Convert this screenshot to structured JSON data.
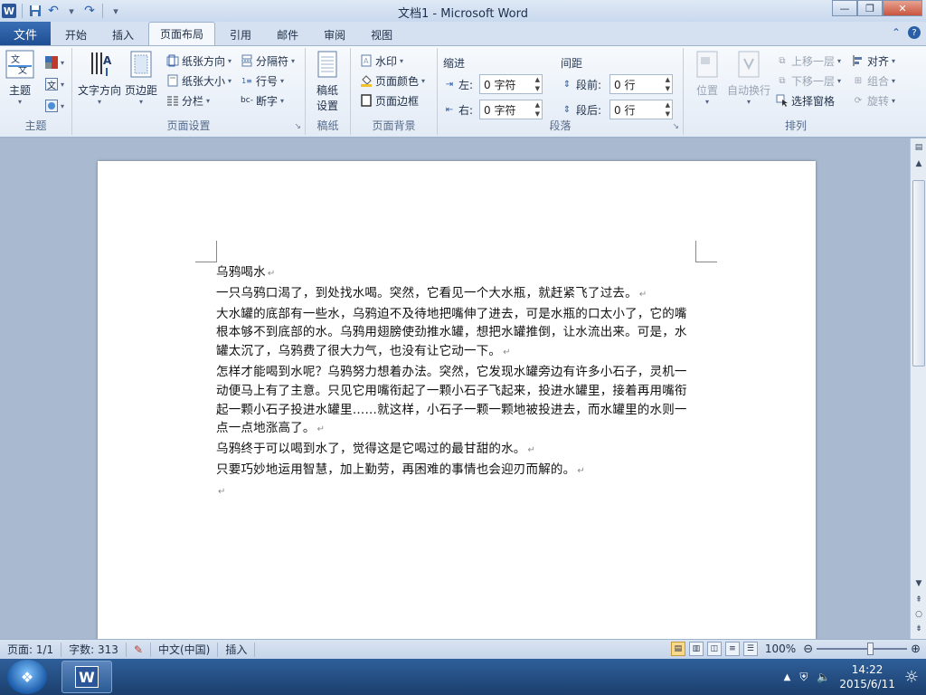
{
  "window": {
    "title": "文档1 - Microsoft Word"
  },
  "tabs": {
    "file": "文件",
    "items": [
      "开始",
      "插入",
      "页面布局",
      "引用",
      "邮件",
      "审阅",
      "视图"
    ],
    "active": "页面布局"
  },
  "ribbon": {
    "theme": {
      "label": "主题",
      "button": "主题"
    },
    "page_setup": {
      "label": "页面设置",
      "text_direction": "文字方向",
      "margins": "页边距",
      "orientation": "纸张方向",
      "size": "纸张大小",
      "columns": "分栏",
      "breaks": "分隔符",
      "line_numbers": "行号",
      "hyphenation": "断字"
    },
    "draft_paper": {
      "label": "稿纸",
      "button_line1": "稿纸",
      "button_line2": "设置"
    },
    "page_background": {
      "label": "页面背景",
      "watermark": "水印",
      "page_color": "页面颜色",
      "page_borders": "页面边框"
    },
    "paragraph": {
      "label": "段落",
      "indent_title": "缩进",
      "spacing_title": "间距",
      "left_label": "左:",
      "left_value": "0 字符",
      "right_label": "右:",
      "right_value": "0 字符",
      "before_label": "段前:",
      "before_value": "0 行",
      "after_label": "段后:",
      "after_value": "0 行"
    },
    "arrange": {
      "label": "排列",
      "position": "位置",
      "wrap_text": "自动换行",
      "bring_forward": "上移一层",
      "send_backward": "下移一层",
      "selection_pane": "选择窗格",
      "align": "对齐",
      "group": "组合",
      "rotate": "旋转"
    }
  },
  "document": {
    "paragraphs": [
      "乌鸦喝水",
      "一只乌鸦口渴了，到处找水喝。突然，它看见一个大水瓶，就赶紧飞了过去。",
      "大水罐的底部有一些水，乌鸦迫不及待地把嘴伸了进去，可是水瓶的口太小了，它的嘴根本够不到底部的水。乌鸦用翅膀使劲推水罐，想把水罐推倒，让水流出来。可是，水罐太沉了，乌鸦费了很大力气，也没有让它动一下。",
      "怎样才能喝到水呢？乌鸦努力想着办法。突然，它发现水罐旁边有许多小石子，灵机一动便马上有了主意。只见它用嘴衔起了一颗小石子飞起来，投进水罐里，接着再用嘴衔起一颗小石子投进水罐里……就这样，小石子一颗一颗地被投进去，而水罐里的水则一点一点地涨高了。",
      "乌鸦终于可以喝到水了，觉得这是它喝过的最甘甜的水。",
      "只要巧妙地运用智慧，加上勤劳，再困难的事情也会迎刃而解的。",
      ""
    ],
    "paragraph_mark": "↵"
  },
  "statusbar": {
    "page": "页面: 1/1",
    "words": "字数: 313",
    "language": "中文(中国)",
    "mode": "插入",
    "zoom": "100%"
  },
  "taskbar": {
    "time": "14:22",
    "date": "2015/6/11"
  }
}
